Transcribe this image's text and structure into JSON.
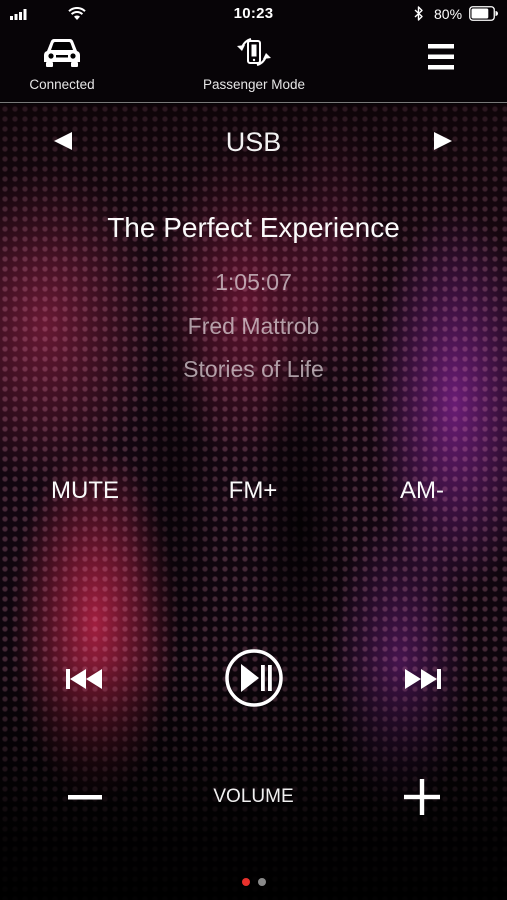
{
  "status_bar": {
    "time": "10:23",
    "battery_percent": "80%",
    "battery_level": 0.8,
    "icons": [
      "signal-icon",
      "wifi-icon",
      "bluetooth-icon",
      "battery-icon"
    ]
  },
  "nav": {
    "connected_label": "Connected",
    "connected_icon": "car-icon",
    "passenger_label": "Passenger Mode",
    "passenger_icon": "phone-rotate-icon",
    "menu_icon": "hamburger-menu-icon"
  },
  "source": {
    "name": "USB",
    "prev_icon": "triangle-left-icon",
    "next_icon": "triangle-right-icon"
  },
  "track": {
    "title": "The Perfect Experience",
    "time": "1:05:07",
    "artist": "Fred Mattrob",
    "album": "Stories of Life"
  },
  "presets": {
    "mute": "MUTE",
    "fm": "FM+",
    "am": "AM-"
  },
  "transport": {
    "prev_icon": "skip-previous-icon",
    "play_icon": "play-pause-icon",
    "next_icon": "skip-next-icon"
  },
  "volume": {
    "label": "VOLUME",
    "minus_icon": "minus-icon",
    "plus_icon": "plus-icon"
  },
  "pager": {
    "pages": 2,
    "active_index": 0,
    "active_color": "#e8312c",
    "inactive_color": "#8a8a8a"
  }
}
